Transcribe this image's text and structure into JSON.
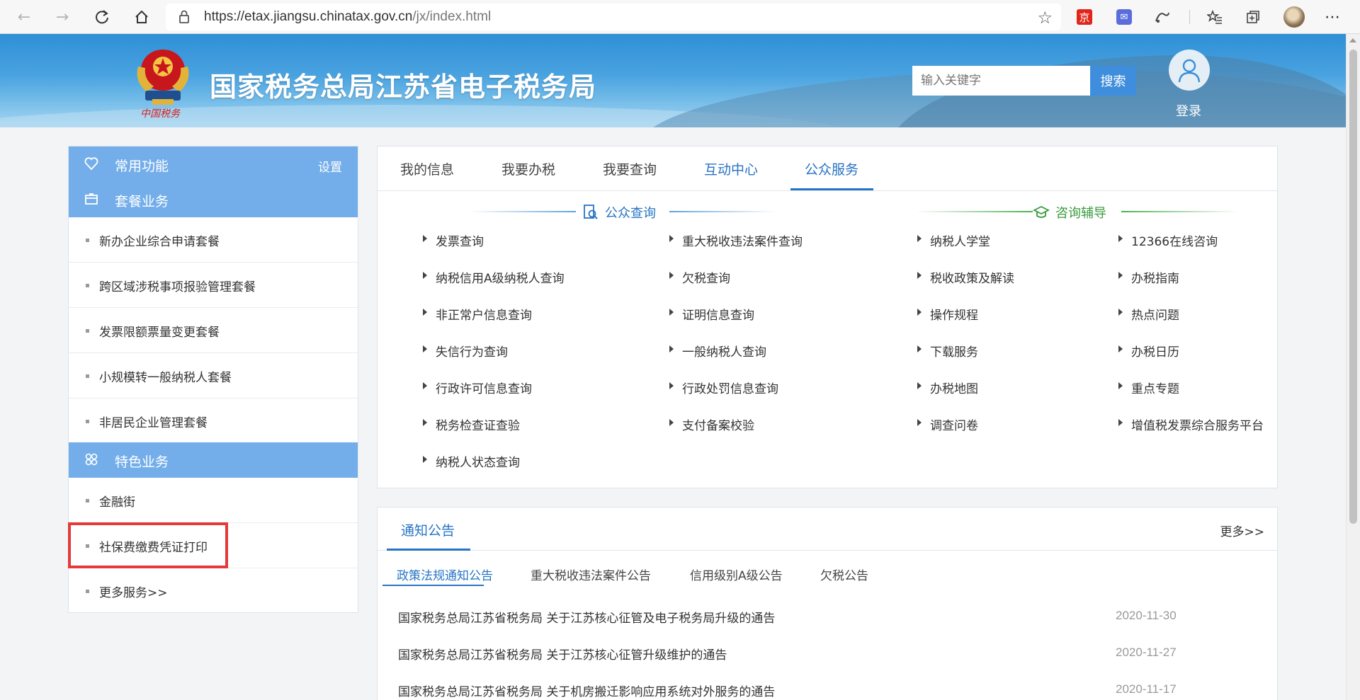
{
  "browser": {
    "url_host": "https://etax.jiangsu.chinatax.gov.cn",
    "url_path": "/jx/index.html",
    "ext_jd_label": "京",
    "ext_mail_label": "✉"
  },
  "header": {
    "title": "国家税务总局江苏省电子税务局",
    "search_placeholder": "输入关键字",
    "search_button": "搜索",
    "login_label": "登录"
  },
  "sidebar": {
    "common": {
      "label": "常用功能",
      "setting": "设置"
    },
    "package": {
      "label": "套餐业务",
      "items": [
        "新办企业综合申请套餐",
        "跨区域涉税事项报验管理套餐",
        "发票限额票量变更套餐",
        "小规模转一般纳税人套餐",
        "非居民企业管理套餐"
      ]
    },
    "special": {
      "label": "特色业务",
      "items": [
        "金融街",
        "社保费缴费凭证打印",
        "更多服务>>"
      ]
    }
  },
  "main": {
    "tabs": [
      "我的信息",
      "我要办税",
      "我要查询",
      "互动中心",
      "公众服务"
    ],
    "public_query": {
      "title": "公众查询",
      "col1": [
        "发票查询",
        "纳税信用A级纳税人查询",
        "非正常户信息查询",
        "失信行为查询",
        "行政许可信息查询",
        "税务检查证查验",
        "纳税人状态查询"
      ],
      "col2": [
        "重大税收违法案件查询",
        "欠税查询",
        "证明信息查询",
        "一般纳税人查询",
        "行政处罚信息查询",
        "支付备案校验"
      ]
    },
    "consult": {
      "title": "咨询辅导",
      "col1": [
        "纳税人学堂",
        "税收政策及解读",
        "操作规程",
        "下载服务",
        "办税地图",
        "调查问卷"
      ],
      "col2": [
        "12366在线咨询",
        "办税指南",
        "热点问题",
        "办税日历",
        "重点专题",
        "增值税发票综合服务平台"
      ]
    }
  },
  "notice": {
    "title": "通知公告",
    "more": "更多>>",
    "tabs": [
      "政策法规通知公告",
      "重大税收违法案件公告",
      "信用级别A级公告",
      "欠税公告"
    ],
    "rows": [
      {
        "title": "国家税务总局江苏省税务局 关于江苏核心征管及电子税务局升级的通告",
        "date": "2020-11-30"
      },
      {
        "title": "国家税务总局江苏省税务局 关于江苏核心征管升级维护的通告",
        "date": "2020-11-27"
      },
      {
        "title": "国家税务总局江苏省税务局 关于机房搬迁影响应用系统对外服务的通告",
        "date": "2020-11-17"
      }
    ]
  },
  "colors": {
    "accent": "#2874c4",
    "sidebar_header": "#74aeea",
    "highlight": "#e53a3a"
  }
}
